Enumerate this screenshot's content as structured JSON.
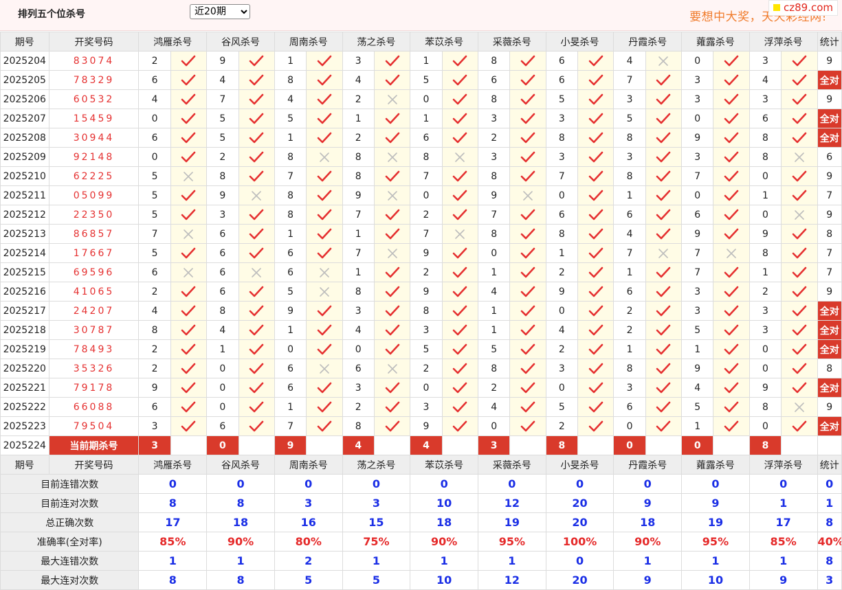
{
  "header": {
    "title": "排列五个位杀号",
    "range_selected": "近20期",
    "slogan": "要想中大奖，天天彩经网!",
    "logo": "cz89.com"
  },
  "columns": {
    "period": "期号",
    "draw": "开奖号码",
    "experts": [
      "鸿雁杀号",
      "谷风杀号",
      "周南杀号",
      "荡之杀号",
      "苯苡杀号",
      "采薇杀号",
      "小旻杀号",
      "丹霞杀号",
      "蕹露杀号",
      "浮萍杀号"
    ],
    "stat": "统计"
  },
  "rows": [
    {
      "period": "2025204",
      "draw": "83074",
      "kills": [
        2,
        9,
        1,
        3,
        1,
        8,
        6,
        4,
        0,
        3
      ],
      "ok": [
        1,
        1,
        1,
        1,
        1,
        1,
        1,
        0,
        1,
        1
      ],
      "stat": "9"
    },
    {
      "period": "2025205",
      "draw": "78329",
      "kills": [
        6,
        4,
        8,
        4,
        5,
        6,
        6,
        7,
        3,
        4
      ],
      "ok": [
        1,
        1,
        1,
        1,
        1,
        1,
        1,
        1,
        1,
        1
      ],
      "stat": "全对"
    },
    {
      "period": "2025206",
      "draw": "60532",
      "kills": [
        4,
        7,
        4,
        2,
        0,
        8,
        5,
        3,
        3,
        3
      ],
      "ok": [
        1,
        1,
        1,
        0,
        1,
        1,
        1,
        1,
        1,
        1
      ],
      "stat": "9"
    },
    {
      "period": "2025207",
      "draw": "15459",
      "kills": [
        0,
        5,
        5,
        1,
        1,
        3,
        3,
        5,
        0,
        6
      ],
      "ok": [
        1,
        1,
        1,
        1,
        1,
        1,
        1,
        1,
        1,
        1
      ],
      "stat": "全对"
    },
    {
      "period": "2025208",
      "draw": "30944",
      "kills": [
        6,
        5,
        1,
        2,
        6,
        2,
        8,
        8,
        9,
        8
      ],
      "ok": [
        1,
        1,
        1,
        1,
        1,
        1,
        1,
        1,
        1,
        1
      ],
      "stat": "全对"
    },
    {
      "period": "2025209",
      "draw": "92148",
      "kills": [
        0,
        2,
        8,
        8,
        8,
        3,
        3,
        3,
        3,
        8
      ],
      "ok": [
        1,
        1,
        0,
        0,
        0,
        1,
        1,
        1,
        1,
        0
      ],
      "stat": "6"
    },
    {
      "period": "2025210",
      "draw": "62225",
      "kills": [
        5,
        8,
        7,
        8,
        7,
        8,
        7,
        8,
        7,
        0
      ],
      "ok": [
        0,
        1,
        1,
        1,
        1,
        1,
        1,
        1,
        1,
        1
      ],
      "stat": "9"
    },
    {
      "period": "2025211",
      "draw": "05099",
      "kills": [
        5,
        9,
        8,
        9,
        0,
        9,
        0,
        1,
        0,
        1
      ],
      "ok": [
        1,
        0,
        1,
        0,
        1,
        0,
        1,
        1,
        1,
        1
      ],
      "stat": "7"
    },
    {
      "period": "2025212",
      "draw": "22350",
      "kills": [
        5,
        3,
        8,
        7,
        2,
        7,
        6,
        6,
        6,
        0
      ],
      "ok": [
        1,
        1,
        1,
        1,
        1,
        1,
        1,
        1,
        1,
        0
      ],
      "stat": "9"
    },
    {
      "period": "2025213",
      "draw": "86857",
      "kills": [
        7,
        6,
        1,
        1,
        7,
        8,
        8,
        4,
        9,
        9
      ],
      "ok": [
        0,
        1,
        1,
        1,
        0,
        1,
        1,
        1,
        1,
        1
      ],
      "stat": "8"
    },
    {
      "period": "2025214",
      "draw": "17667",
      "kills": [
        5,
        6,
        6,
        7,
        9,
        0,
        1,
        7,
        7,
        8
      ],
      "ok": [
        1,
        1,
        1,
        0,
        1,
        1,
        1,
        0,
        0,
        1
      ],
      "stat": "7"
    },
    {
      "period": "2025215",
      "draw": "69596",
      "kills": [
        6,
        6,
        6,
        1,
        2,
        1,
        2,
        1,
        7,
        1
      ],
      "ok": [
        0,
        0,
        0,
        1,
        1,
        1,
        1,
        1,
        1,
        1
      ],
      "stat": "7"
    },
    {
      "period": "2025216",
      "draw": "41065",
      "kills": [
        2,
        6,
        5,
        8,
        9,
        4,
        9,
        6,
        3,
        2
      ],
      "ok": [
        1,
        1,
        0,
        1,
        1,
        1,
        1,
        1,
        1,
        1
      ],
      "stat": "9"
    },
    {
      "period": "2025217",
      "draw": "24207",
      "kills": [
        4,
        8,
        9,
        3,
        8,
        1,
        0,
        2,
        3,
        3
      ],
      "ok": [
        1,
        1,
        1,
        1,
        1,
        1,
        1,
        1,
        1,
        1
      ],
      "stat": "全对"
    },
    {
      "period": "2025218",
      "draw": "30787",
      "kills": [
        8,
        4,
        1,
        4,
        3,
        1,
        4,
        2,
        5,
        3
      ],
      "ok": [
        1,
        1,
        1,
        1,
        1,
        1,
        1,
        1,
        1,
        1
      ],
      "stat": "全对"
    },
    {
      "period": "2025219",
      "draw": "78493",
      "kills": [
        2,
        1,
        0,
        0,
        5,
        5,
        2,
        1,
        1,
        0
      ],
      "ok": [
        1,
        1,
        1,
        1,
        1,
        1,
        1,
        1,
        1,
        1
      ],
      "stat": "全对"
    },
    {
      "period": "2025220",
      "draw": "35326",
      "kills": [
        2,
        0,
        6,
        6,
        2,
        8,
        3,
        8,
        9,
        0
      ],
      "ok": [
        1,
        1,
        0,
        0,
        1,
        1,
        1,
        1,
        1,
        1
      ],
      "stat": "8"
    },
    {
      "period": "2025221",
      "draw": "79178",
      "kills": [
        9,
        0,
        6,
        3,
        0,
        2,
        0,
        3,
        4,
        9
      ],
      "ok": [
        1,
        1,
        1,
        1,
        1,
        1,
        1,
        1,
        1,
        1
      ],
      "stat": "全对"
    },
    {
      "period": "2025222",
      "draw": "66088",
      "kills": [
        6,
        0,
        1,
        2,
        3,
        4,
        5,
        6,
        5,
        8
      ],
      "ok": [
        1,
        1,
        1,
        1,
        1,
        1,
        1,
        1,
        1,
        0
      ],
      "stat": "9"
    },
    {
      "period": "2025223",
      "draw": "79504",
      "kills": [
        3,
        6,
        7,
        8,
        9,
        0,
        2,
        0,
        1,
        0
      ],
      "ok": [
        1,
        1,
        1,
        1,
        1,
        1,
        1,
        1,
        1,
        1
      ],
      "stat": "全对"
    }
  ],
  "current": {
    "period": "2025224",
    "label": "当前期杀号",
    "kills": [
      3,
      0,
      9,
      4,
      4,
      3,
      8,
      0,
      0,
      8
    ]
  },
  "summary": [
    {
      "label": "目前连错次数",
      "values": [
        "0",
        "0",
        "0",
        "0",
        "0",
        "0",
        "0",
        "0",
        "0",
        "0"
      ],
      "stat": "0",
      "red": false
    },
    {
      "label": "目前连对次数",
      "values": [
        "8",
        "8",
        "3",
        "3",
        "10",
        "12",
        "20",
        "9",
        "9",
        "1"
      ],
      "stat": "1",
      "red": false
    },
    {
      "label": "总正确次数",
      "values": [
        "17",
        "18",
        "16",
        "15",
        "18",
        "19",
        "20",
        "18",
        "19",
        "17"
      ],
      "stat": "8",
      "red": false
    },
    {
      "label": "准确率(全对率)",
      "values": [
        "85%",
        "90%",
        "80%",
        "75%",
        "90%",
        "95%",
        "100%",
        "90%",
        "95%",
        "85%"
      ],
      "stat": "40%",
      "red": true
    },
    {
      "label": "最大连错次数",
      "values": [
        "1",
        "1",
        "2",
        "1",
        "1",
        "1",
        "0",
        "1",
        "1",
        "1"
      ],
      "stat": "8",
      "red": false
    },
    {
      "label": "最大连对次数",
      "values": [
        "8",
        "8",
        "5",
        "5",
        "10",
        "12",
        "20",
        "9",
        "10",
        "9"
      ],
      "stat": "3",
      "red": false
    }
  ],
  "icons": {
    "ok": "check-icon",
    "ng": "cross-icon"
  },
  "colors": {
    "accent": "#d93a2b",
    "check": "#e53030",
    "cross": "#bdbdbd",
    "stat_blue": "#1a2ee6",
    "slogan": "#f07b2b"
  }
}
